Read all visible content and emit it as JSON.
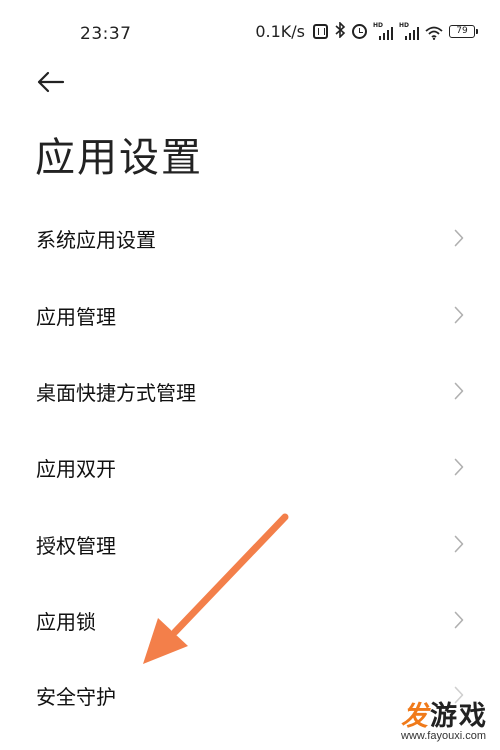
{
  "status_bar": {
    "time": "23:37",
    "net_speed": "0.1K/s",
    "battery_level": "79",
    "icons": [
      "nfc-icon",
      "bluetooth-icon",
      "alarm-icon",
      "signal-hd-icon",
      "signal-hd-icon",
      "wifi-icon",
      "battery-icon"
    ],
    "signal_badge": "HD"
  },
  "header": {
    "back_icon": "arrow-left-icon",
    "title": "应用设置"
  },
  "settings_items": [
    {
      "label": "系统应用设置",
      "icon": "chevron-right-icon"
    },
    {
      "label": "应用管理",
      "icon": "chevron-right-icon"
    },
    {
      "label": "桌面快捷方式管理",
      "icon": "chevron-right-icon"
    },
    {
      "label": "应用双开",
      "icon": "chevron-right-icon"
    },
    {
      "label": "授权管理",
      "icon": "chevron-right-icon"
    },
    {
      "label": "应用锁",
      "icon": "chevron-right-icon"
    },
    {
      "label": "安全守护",
      "icon": "chevron-right-icon"
    }
  ],
  "annotation": {
    "color": "#f37f4a",
    "icon": "pointing-arrow"
  },
  "watermark": {
    "brand_highlight": "发",
    "brand_rest": "游戏",
    "url": "www.fayouxi.com",
    "highlight_color": "#f07a1a"
  }
}
